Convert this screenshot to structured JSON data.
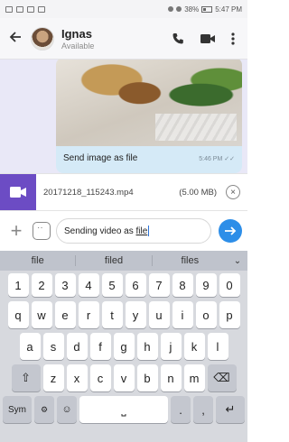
{
  "status_bar": {
    "time": "5:47 PM",
    "battery": "38%"
  },
  "header": {
    "contact_name": "Ignas",
    "contact_status": "Available",
    "back_icon": "arrow-left-icon",
    "call_icon": "phone-icon",
    "video_icon": "video-icon",
    "menu_icon": "more-vert-icon"
  },
  "chat": {
    "bubble_text": "Send image as file",
    "bubble_time": "5:46 PM"
  },
  "attachment": {
    "filename": "20171218_115243.mp4",
    "size": "(5.00 MB)",
    "close_icon": "close-icon"
  },
  "composer": {
    "text_before": "Sending video as ",
    "text_underlined": "file",
    "plus_icon": "plus-icon",
    "emoji_icon": "sticker-icon",
    "send_icon": "send-arrow-icon"
  },
  "suggestions": [
    "file",
    "filed",
    "files"
  ],
  "keyboard": {
    "row1": [
      "1",
      "2",
      "3",
      "4",
      "5",
      "6",
      "7",
      "8",
      "9",
      "0"
    ],
    "row2": [
      "q",
      "w",
      "e",
      "r",
      "t",
      "y",
      "u",
      "i",
      "o",
      "p"
    ],
    "row3": [
      "a",
      "s",
      "d",
      "f",
      "g",
      "h",
      "j",
      "k",
      "l"
    ],
    "row4": [
      "z",
      "x",
      "c",
      "v",
      "b",
      "n",
      "m"
    ],
    "sym_label": "Sym",
    "period_label": ".",
    "comma_label": ","
  }
}
